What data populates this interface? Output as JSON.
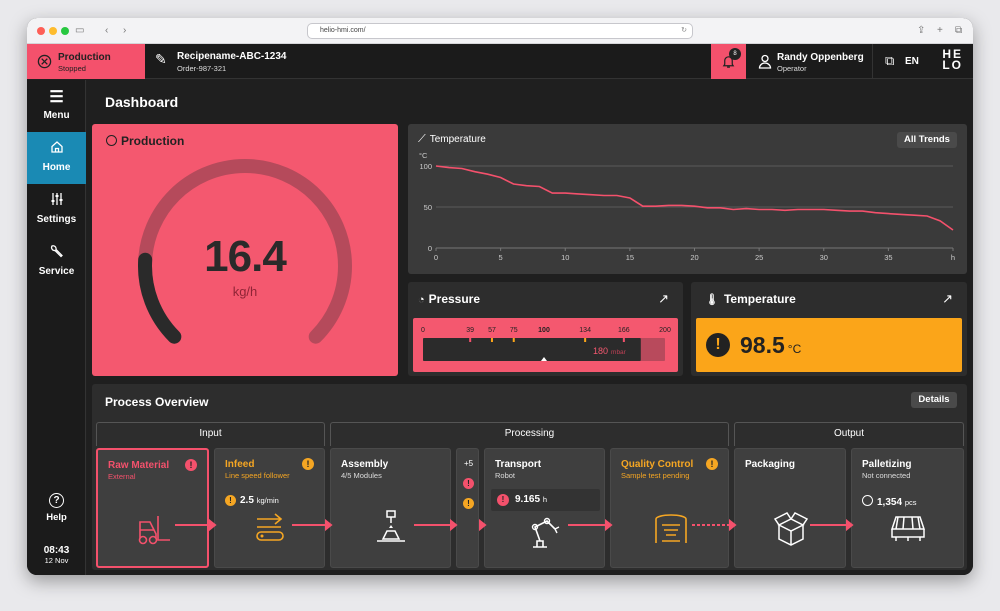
{
  "browser": {
    "url": "helio-hmi.com/"
  },
  "header": {
    "production_label": "Production",
    "production_status": "Stopped",
    "recipe_name": "Recipename-ABC-1234",
    "order": "Order-987-321",
    "notification_count": "8",
    "user_name": "Randy Oppenberg",
    "user_role": "Operator",
    "language": "EN",
    "logo_top": "HE",
    "logo_bottom": "LO"
  },
  "sidebar": {
    "items": [
      {
        "label": "Menu",
        "icon": "menu-icon"
      },
      {
        "label": "Home",
        "icon": "home-icon"
      },
      {
        "label": "Settings",
        "icon": "sliders-icon"
      },
      {
        "label": "Service",
        "icon": "wrench-icon"
      }
    ],
    "help_label": "Help",
    "time": "08:43",
    "date": "12 Nov"
  },
  "dashboard": {
    "title": "Dashboard",
    "production": {
      "title": "Production",
      "value": "16.4",
      "unit": "kg/h",
      "gauge_fraction": 0.18
    },
    "temperature_trend": {
      "title": "Temperature",
      "button": "All Trends"
    },
    "pressure": {
      "title": "Pressure",
      "scale_labels": [
        "0",
        "39",
        "57",
        "75",
        "100",
        "134",
        "166",
        "200"
      ],
      "value": "180",
      "unit": "mbar",
      "value_number": 180,
      "max": 200
    },
    "temperature": {
      "title": "Temperature",
      "value": "98.5",
      "unit": "°C"
    }
  },
  "chart_data": {
    "type": "line",
    "title": "Temperature",
    "ylabel": "°C",
    "xlabel": "h",
    "ylim": [
      0,
      100
    ],
    "xlim": [
      0,
      40
    ],
    "x_ticks": [
      "0",
      "5",
      "10",
      "15",
      "20",
      "25",
      "30",
      "35",
      "h"
    ],
    "y_ticks": [
      "0",
      "50",
      "100"
    ],
    "x": [
      0,
      1,
      2,
      3,
      4,
      5,
      6,
      7,
      8,
      9,
      10,
      11,
      12,
      13,
      14,
      15,
      16,
      17,
      18,
      19,
      20,
      21,
      22,
      23,
      24,
      25,
      26,
      27,
      28,
      29,
      30,
      31,
      32,
      33,
      34,
      35,
      36,
      37,
      38,
      39,
      40
    ],
    "values": [
      100,
      98,
      97,
      93,
      90,
      86,
      78,
      76,
      75,
      67,
      67,
      66,
      65,
      64,
      64,
      61,
      51,
      51,
      52,
      52,
      51,
      49,
      49,
      47,
      48,
      47,
      47,
      46,
      47,
      47,
      47,
      46,
      45,
      45,
      43,
      42,
      41,
      40,
      39,
      33,
      22
    ],
    "grid": true
  },
  "process": {
    "title": "Process Overview",
    "details_button": "Details",
    "groups": [
      "Input",
      "Processing",
      "Output"
    ],
    "stages": [
      {
        "title": "Raw Material",
        "subtitle": "External",
        "state": "error",
        "icon": "forklift-icon"
      },
      {
        "title": "Infeed",
        "subtitle": "Line speed follower",
        "state": "warning",
        "metric": "2.5",
        "metric_unit": "kg/min",
        "icon": "conveyor-icon"
      },
      {
        "title": "Assembly",
        "subtitle": "4/5 Modules",
        "state": "normal",
        "icon": "assembly-icon"
      },
      {
        "title": "Transport",
        "subtitle": "Robot",
        "state": "normal",
        "metric": "9.165",
        "metric_unit": "h",
        "icon": "robot-arm-icon"
      },
      {
        "title": "Quality Control",
        "subtitle": "Sample test pending",
        "state": "warning",
        "icon": "scanner-icon"
      },
      {
        "title": "Packaging",
        "subtitle": "",
        "state": "normal",
        "icon": "box-icon"
      },
      {
        "title": "Palletizing",
        "subtitle": "Not connected",
        "state": "normal",
        "metric": "1,354",
        "metric_unit": "pcs",
        "icon": "pallet-icon"
      }
    ],
    "more_count": "+5"
  }
}
